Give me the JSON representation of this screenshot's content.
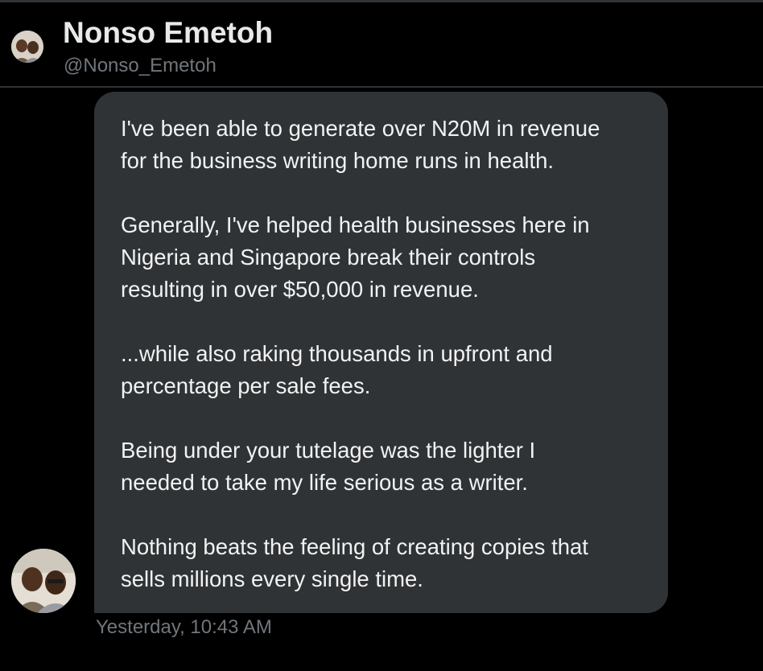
{
  "header": {
    "display_name": "Nonso Emetoh",
    "handle": "@Nonso_Emetoh"
  },
  "message": {
    "paragraphs": [
      [
        "I've been able to generate over N20M in revenue",
        "for the business writing home runs in health."
      ],
      [
        "Generally, I've helped health businesses here in",
        "Nigeria and Singapore break their controls",
        "resulting in over $50,000 in revenue."
      ],
      [
        "...while also raking thousands in upfront and",
        "percentage per sale fees."
      ],
      [
        "Being under your tutelage was the lighter I",
        "needed to take my life serious as a writer."
      ],
      [
        "Nothing beats the feeling of creating copies that",
        "sells millions every single time."
      ]
    ],
    "timestamp": "Yesterday, 10:43 AM"
  },
  "colors": {
    "background": "#000000",
    "bubble": "#2f3336",
    "text_primary": "#e7e9ea",
    "text_secondary": "#71767b"
  },
  "icons": {
    "header_avatar": "profile-photo-avatar",
    "message_avatar": "profile-photo-avatar"
  }
}
